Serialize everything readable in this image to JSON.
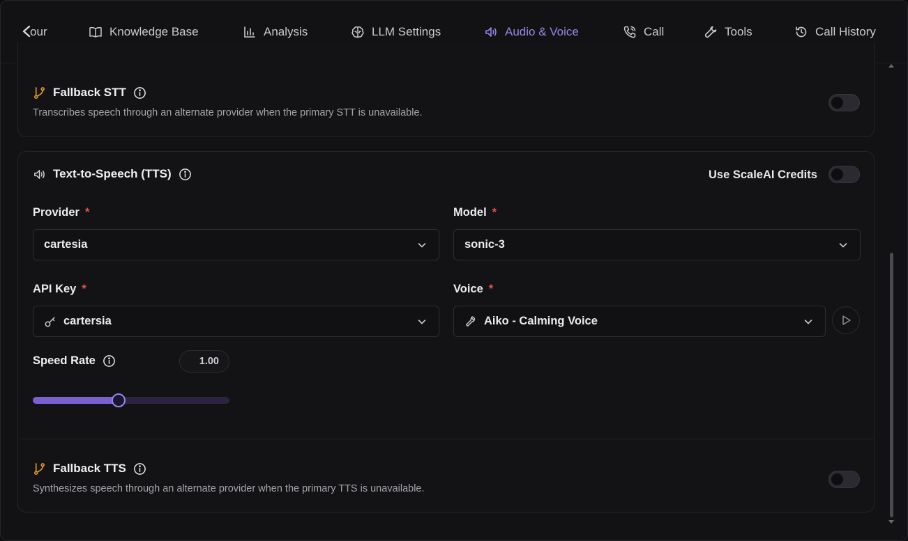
{
  "tabs": [
    {
      "label": "our",
      "icon": "back-arrow-icon",
      "active": false
    },
    {
      "label": "Knowledge Base",
      "icon": "book-icon",
      "active": false
    },
    {
      "label": "Analysis",
      "icon": "bar-chart-icon",
      "active": false
    },
    {
      "label": "LLM Settings",
      "icon": "brain-icon",
      "active": false
    },
    {
      "label": "Audio & Voice",
      "icon": "speaker-icon",
      "active": true
    },
    {
      "label": "Call",
      "icon": "phone-icon",
      "active": false
    },
    {
      "label": "Tools",
      "icon": "wrench-icon",
      "active": false
    },
    {
      "label": "Call History",
      "icon": "history-icon",
      "active": false
    }
  ],
  "fallback_stt": {
    "title": "Fallback STT",
    "description": "Transcribes speech through an alternate provider when the primary STT is unavailable.",
    "enabled": false
  },
  "tts": {
    "title": "Text-to-Speech (TTS)",
    "credits_label": "Use ScaleAI Credits",
    "credits_enabled": false,
    "provider": {
      "label": "Provider",
      "required": "*",
      "value": "cartesia"
    },
    "model": {
      "label": "Model",
      "required": "*",
      "value": "sonic-3"
    },
    "api_key": {
      "label": "API Key",
      "required": "*",
      "value": "cartersia"
    },
    "voice": {
      "label": "Voice",
      "required": "*",
      "value": "Aiko - Calming Voice"
    },
    "speed": {
      "label": "Speed Rate",
      "value": "1.00",
      "fraction": 0.4375
    }
  },
  "fallback_tts": {
    "title": "Fallback TTS",
    "description": "Synthesizes speech through an alternate provider when the primary TTS is unavailable.",
    "enabled": false
  },
  "colors": {
    "accent": "#8b6fe0",
    "required": "#e5534b",
    "fallback_icon": "#e59a2f"
  }
}
